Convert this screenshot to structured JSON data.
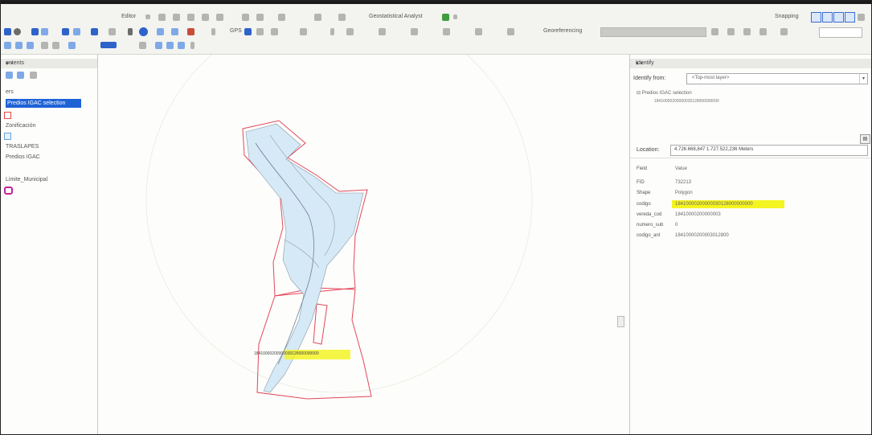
{
  "toolbar": {
    "editor_label": "Editor",
    "geostatistical_label": "Geostatistical Analyst",
    "georeferencing_label": "Georeferencing",
    "gps_label": "GPS",
    "snapping_label": "Snapping"
  },
  "toc": {
    "title": "ontents",
    "layers_label": "ers",
    "selected_layer": "Predios IGAC selection",
    "items": [
      "Zonificación",
      "TRASLAPES",
      "Predios IGAC",
      "Limite_Municipal"
    ]
  },
  "map": {
    "parcel_label": "18410000200000030128000000000"
  },
  "identify": {
    "title": "Identify",
    "from_label": "Identify from:",
    "from_value": "<Top-most layer>",
    "tree_layer": "Predios IGAC selection",
    "tree_feature": "18410000200000030128000000000",
    "location_label": "Location:",
    "location_value": "4.726.668,847  1.727.522,236 Meters",
    "columns": {
      "field": "Field",
      "value": "Value"
    },
    "rows": [
      {
        "field": "FID",
        "value": "732213"
      },
      {
        "field": "Shape",
        "value": "Polygon"
      },
      {
        "field": "codigo",
        "value": "18410000200000030128000000000"
      },
      {
        "field": "vereda_cod",
        "value": "18410000200000003"
      },
      {
        "field": "numero_sub",
        "value": "0"
      },
      {
        "field": "codigo_ant",
        "value": "18410000200003012800"
      }
    ]
  },
  "colors": {
    "selection_blue": "#1e63d6",
    "parcel_outline": "#e2475a",
    "water_fill": "#d5e9f6",
    "highlight": "#f3f324"
  }
}
